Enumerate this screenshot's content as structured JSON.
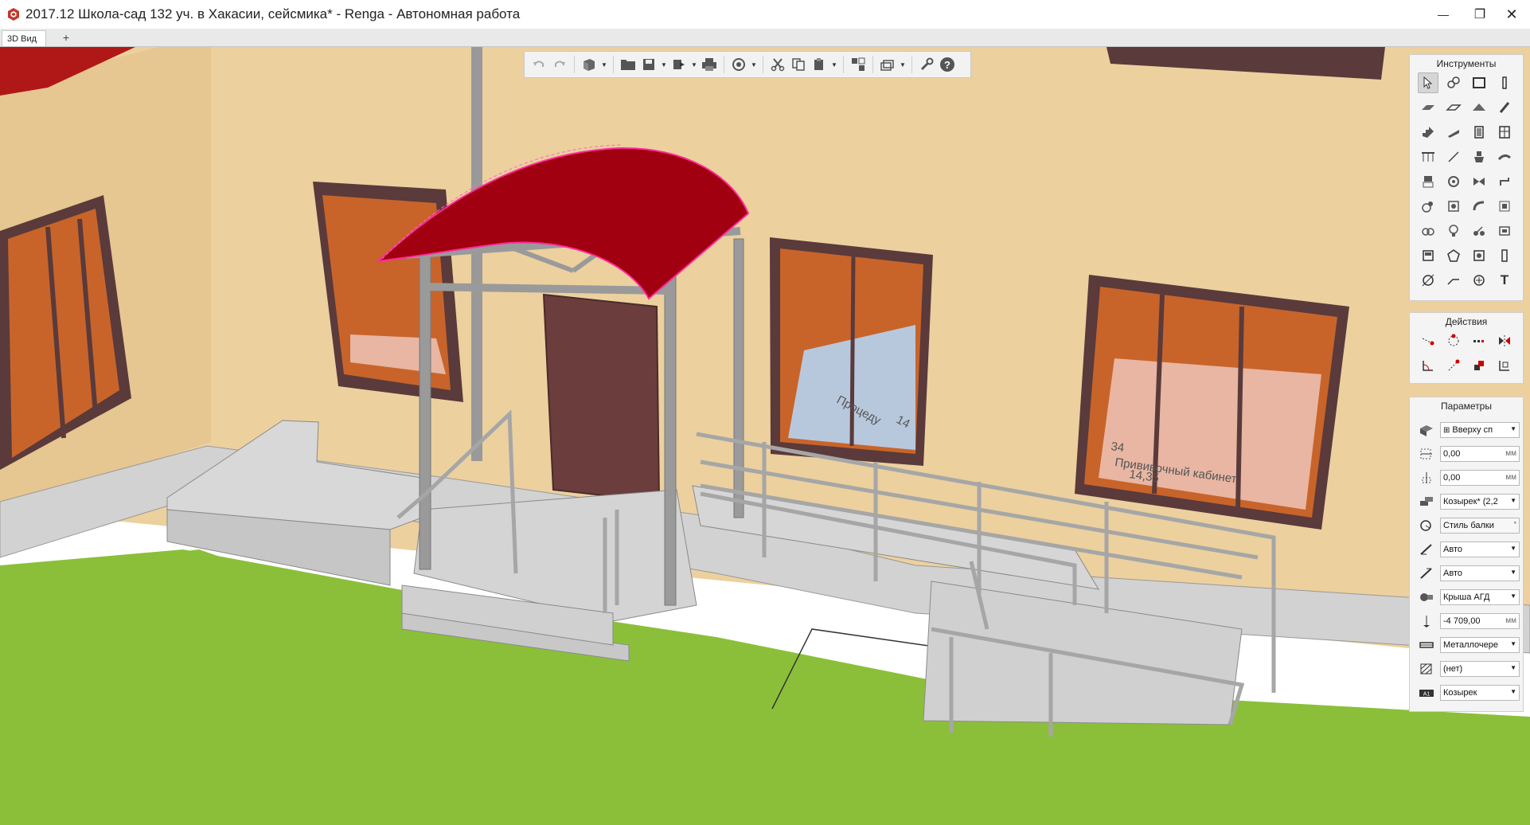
{
  "window": {
    "title": "2017.12 Школа-сад 132 уч. в Хакасии, сейсмика* - Renga - Автономная работа",
    "min_glyph": "—",
    "max_glyph": "❐",
    "close_glyph": "✕"
  },
  "tabs": [
    {
      "label": "3D Вид"
    }
  ],
  "tab_add": "+",
  "toolbar": {
    "buttons": [
      "undo-icon",
      "redo-icon",
      "view-cube-icon",
      "open-folder-icon",
      "save-icon",
      "export-icon",
      "print-icon",
      "orbit-icon",
      "cut-icon",
      "copy-icon",
      "paste-icon",
      "linked-views-icon",
      "layers-icon",
      "settings-wrench-icon",
      "help-icon"
    ]
  },
  "tools_panel": {
    "title": "Инструменты",
    "text_tool_glyph": "T"
  },
  "actions_panel": {
    "title": "Действия"
  },
  "params_panel": {
    "title": "Параметры",
    "rows": [
      {
        "icon": "placement-icon",
        "value": "Вверху сп",
        "type": "select"
      },
      {
        "icon": "offset-x-icon",
        "value": "0,00",
        "unit": "мм",
        "type": "number"
      },
      {
        "icon": "offset-z-icon",
        "value": "0,00",
        "unit": "мм",
        "type": "number"
      },
      {
        "icon": "beam-type-icon",
        "value": "Козырек* (2,2",
        "type": "select"
      },
      {
        "icon": "beam-style-icon",
        "value": "Стиль балки",
        "type": "picker"
      },
      {
        "icon": "start-angle-icon",
        "value": "Авто",
        "type": "select"
      },
      {
        "icon": "end-angle-icon",
        "value": "Авто",
        "type": "select"
      },
      {
        "icon": "layer-icon",
        "value": "Крыша АГД",
        "type": "select"
      },
      {
        "icon": "elevation-icon",
        "value": "-4 709,00",
        "unit": "мм",
        "type": "number"
      },
      {
        "icon": "material-icon",
        "value": "Металлочере",
        "type": "select"
      },
      {
        "icon": "hatch-icon",
        "value": "(нет)",
        "type": "select"
      },
      {
        "icon": "mark-icon",
        "value": "Козырек",
        "type": "select"
      }
    ]
  },
  "scene": {
    "room_labels": [
      {
        "text": "34",
        "position_hint": "right-window"
      },
      {
        "text": "Прививочный кабинет",
        "position_hint": "right-window"
      },
      {
        "text": "14,35",
        "position_hint": "right-window"
      },
      {
        "text": "Процеду",
        "position_hint": "middle-window"
      },
      {
        "text": "14",
        "position_hint": "middle-window"
      }
    ],
    "colors": {
      "wall": "#ecd09e",
      "ground": "#8bbf3a",
      "canopy": "#a00010",
      "concrete": "#c9c9c9",
      "window_frame": "#5a3a3a",
      "window_inner": "#c8642a"
    }
  }
}
